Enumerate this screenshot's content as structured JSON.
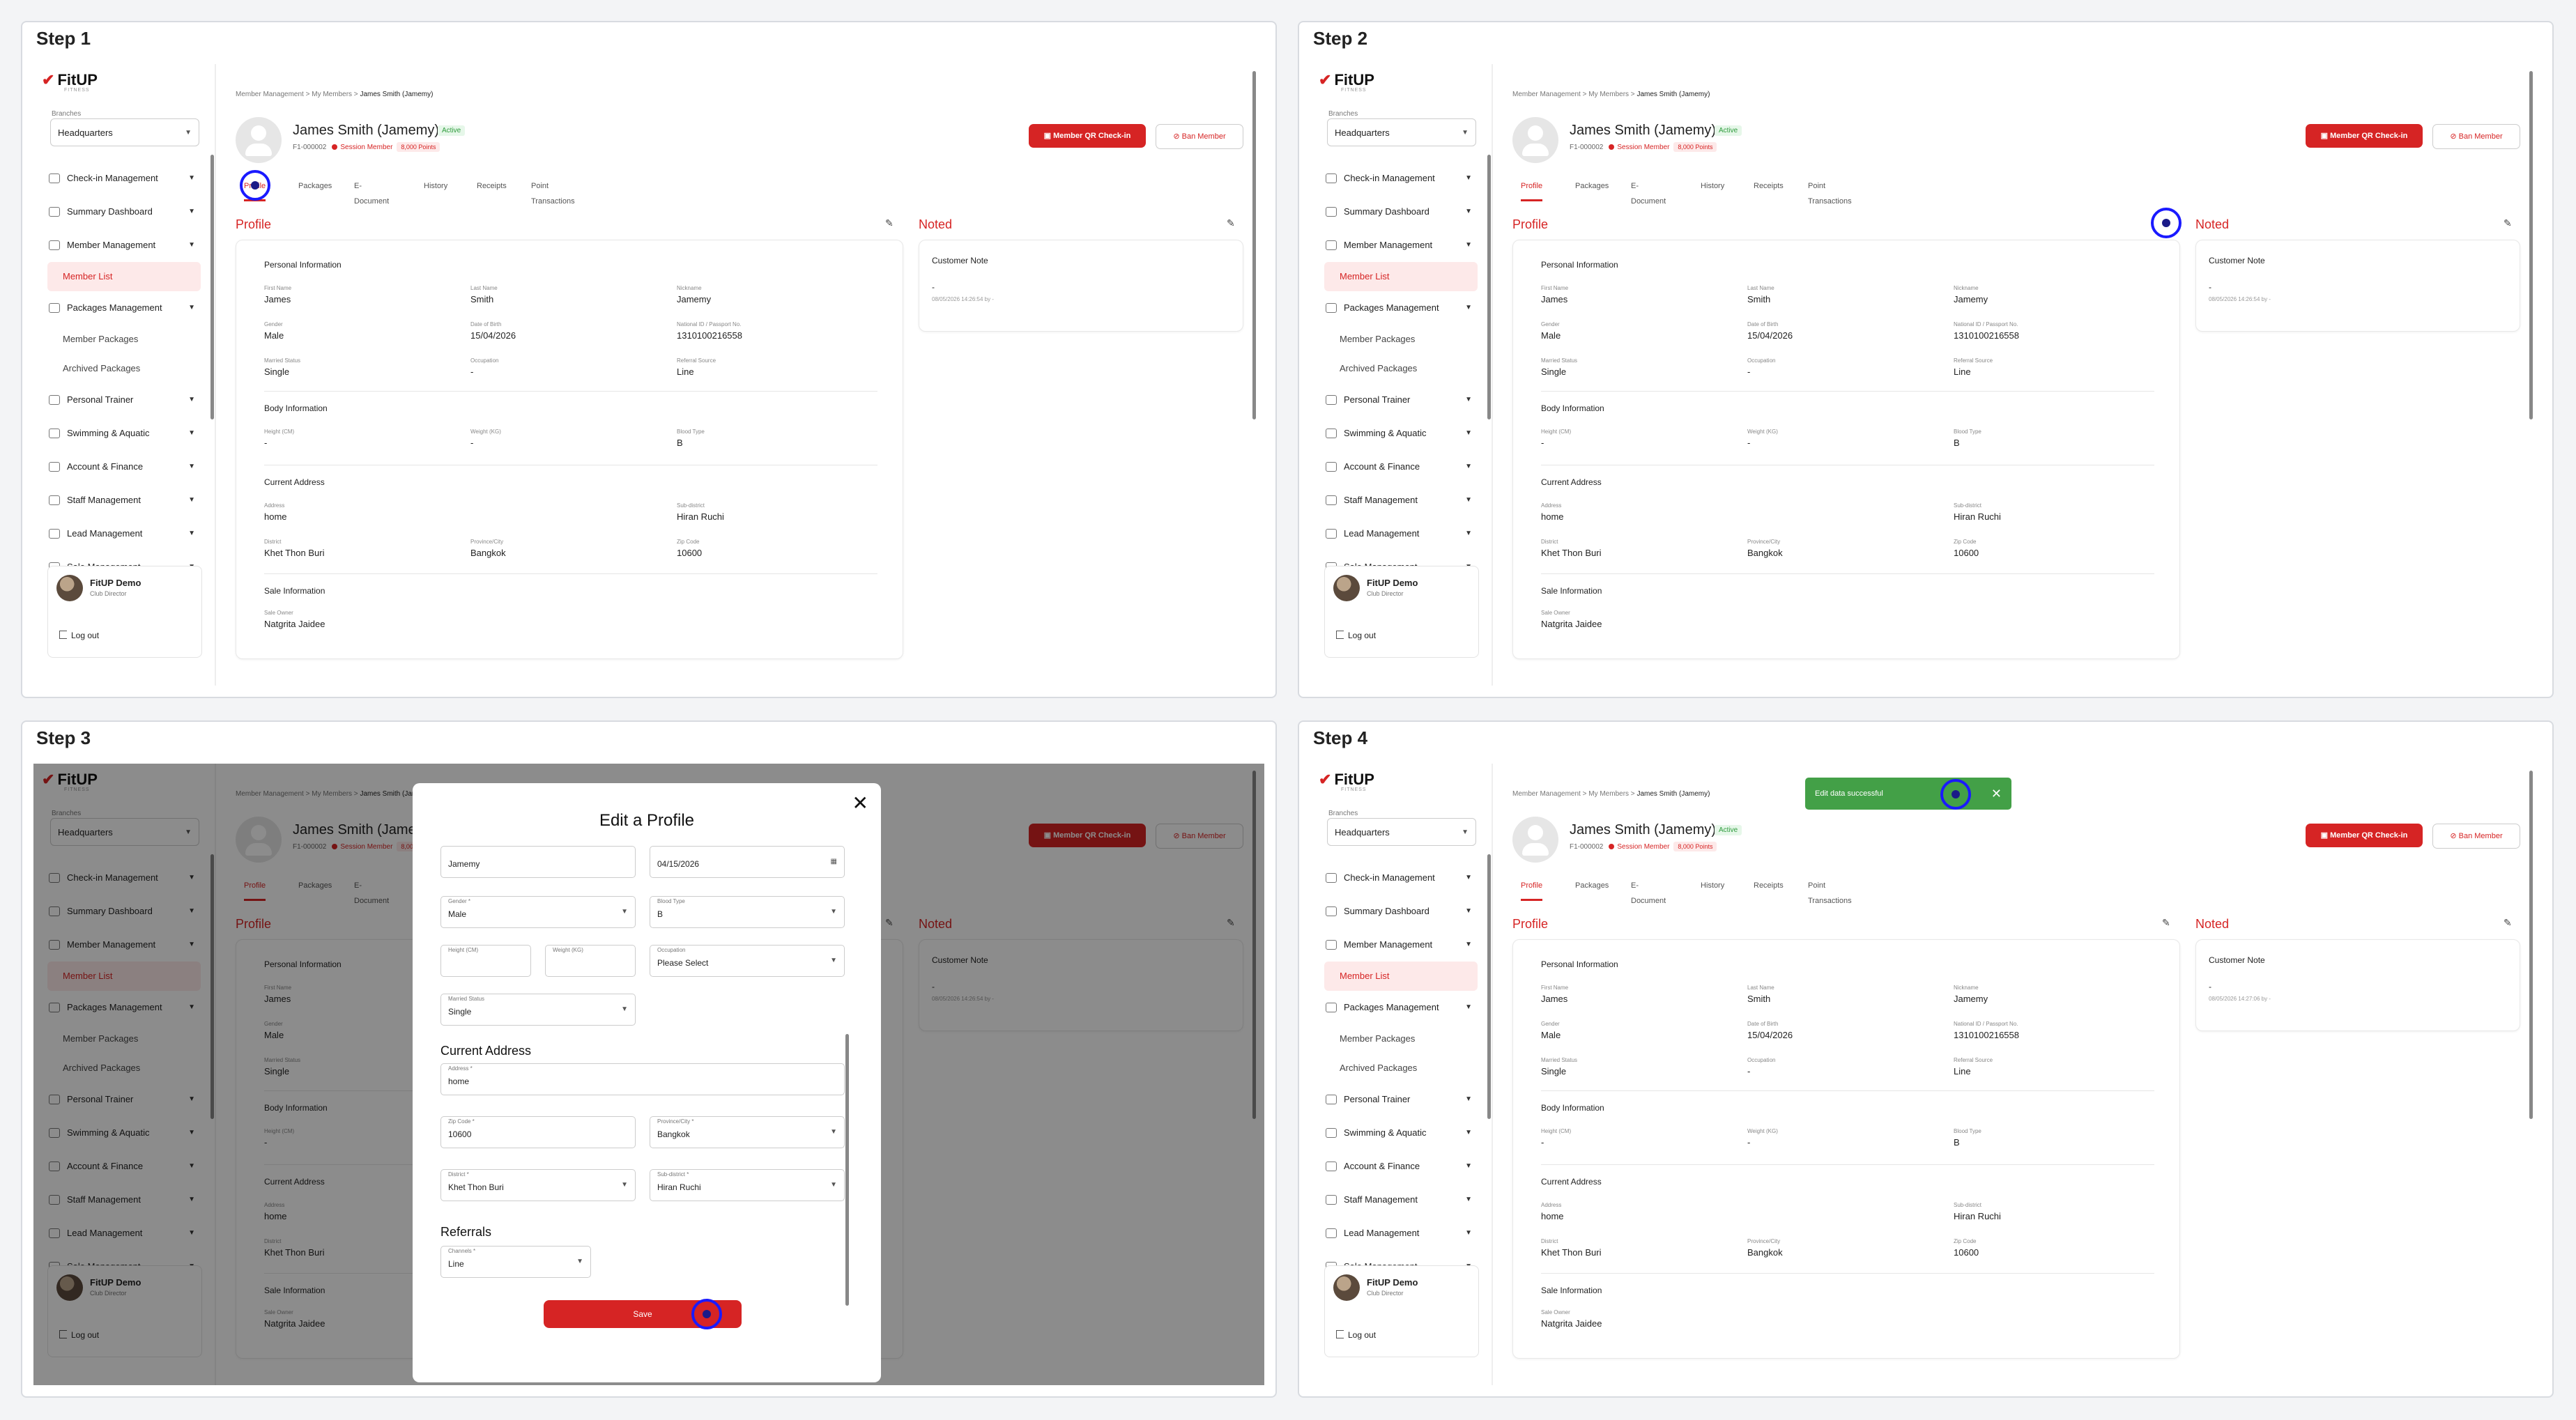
{
  "steps": [
    {
      "title": "Step 1"
    },
    {
      "title": "Step 2"
    },
    {
      "title": "Step 3"
    },
    {
      "title": "Step 4"
    }
  ],
  "sidebar": {
    "logo": "FitUP",
    "logo_sub": "FITNESS",
    "branch_label": "Branches",
    "branch_value": "Headquarters",
    "items": [
      {
        "label": "Check-in Management",
        "icon": "checkin-icon"
      },
      {
        "label": "Summary Dashboard",
        "icon": "dashboard-icon"
      },
      {
        "label": "Member Management",
        "icon": "member-icon"
      },
      {
        "label": "Member List",
        "sub": true
      },
      {
        "label": "Packages Management",
        "icon": "package-icon"
      },
      {
        "label": "Member Packages",
        "sub": true
      },
      {
        "label": "Archived Packages",
        "sub": true
      },
      {
        "label": "Personal Trainer",
        "icon": "trainer-icon"
      },
      {
        "label": "Swimming & Aquatic",
        "icon": "swim-icon"
      },
      {
        "label": "Account & Finance",
        "icon": "finance-icon"
      },
      {
        "label": "Staff Management",
        "icon": "staff-icon"
      },
      {
        "label": "Lead Management",
        "icon": "lead-icon"
      },
      {
        "label": "Sale Management",
        "icon": "sale-icon"
      }
    ],
    "user_name": "FitUP Demo",
    "user_role": "Club Director",
    "logout": "Log out"
  },
  "header": {
    "crumb1": "Member Management",
    "crumb2": "My Members",
    "crumb3": "James Smith (Jamemy)",
    "member_name": "James Smith (Jamemy)",
    "status": "Active",
    "member_id": "F1-000002",
    "session": "Session Member",
    "points": "8,000 Points",
    "qr_button": "Member QR Check-in",
    "ban_button": "Ban Member"
  },
  "tabs": [
    "Profile",
    "Packages",
    "E-Document",
    "History",
    "Receipts",
    "Point Transactions"
  ],
  "profile": {
    "heading": "Profile",
    "personal_heading": "Personal Information",
    "body_heading": "Body Information",
    "address_heading": "Current Address",
    "sale_heading": "Sale Information",
    "first_name_label": "First Name",
    "first_name": "James",
    "last_name_label": "Last Name",
    "last_name": "Smith",
    "nickname_label": "Nickname",
    "nickname": "Jamemy",
    "gender_label": "Gender",
    "gender": "Male",
    "dob_label": "Date of Birth",
    "dob": "15/04/2026",
    "nid_label": "National ID / Passport No.",
    "nid": "1310100216558",
    "marital_label": "Married Status",
    "marital": "Single",
    "occupation_label": "Occupation",
    "occupation": "-",
    "referral_label": "Referral Source",
    "referral": "Line",
    "height_label": "Height (CM)",
    "height": "-",
    "weight_label": "Weight (KG)",
    "weight": "-",
    "blood_label": "Blood Type",
    "blood": "B",
    "address_label": "Address",
    "address": "home",
    "subdistrict_label": "Sub-district",
    "subdistrict": "Hiran Ruchi",
    "district_label": "District",
    "district": "Khet Thon Buri",
    "province_label": "Province/City",
    "province": "Bangkok",
    "zip_label": "Zip Code",
    "zip": "10600",
    "sale_owner_label": "Sale Owner",
    "sale_owner": "Natgrita Jaidee"
  },
  "noted": {
    "heading": "Noted",
    "title": "Customer Note",
    "value": "-",
    "date1": "08/05/2026 14:26:54 by -",
    "date4": "08/05/2026 14:27:06 by -"
  },
  "modal": {
    "title": "Edit a Profile",
    "nickname": "Jamemy",
    "dob": "04/15/2026",
    "gender_label": "Gender *",
    "gender": "Male",
    "blood_label": "Blood Type",
    "blood": "B",
    "height_label": "Height (CM)",
    "weight_label": "Weight (KG)",
    "occupation_label": "Occupation",
    "occupation": "Please Select",
    "marital_label": "Married Status",
    "marital": "Single",
    "address_heading": "Current Address",
    "address_label": "Address *",
    "address": "home",
    "zip_label": "Zip Code *",
    "zip": "10600",
    "province_label": "Province/City *",
    "province": "Bangkok",
    "district_label": "District *",
    "district": "Khet Thon Buri",
    "subdistrict_label": "Sub-district *",
    "subdistrict": "Hiran Ruchi",
    "referrals_heading": "Referrals",
    "channel_label": "Channels *",
    "channel": "Line",
    "save": "Save"
  },
  "toast": {
    "message": "Edit data successful"
  },
  "colors": {
    "accent": "#d62424",
    "success": "#43a047",
    "marker": "#1a1aff"
  }
}
